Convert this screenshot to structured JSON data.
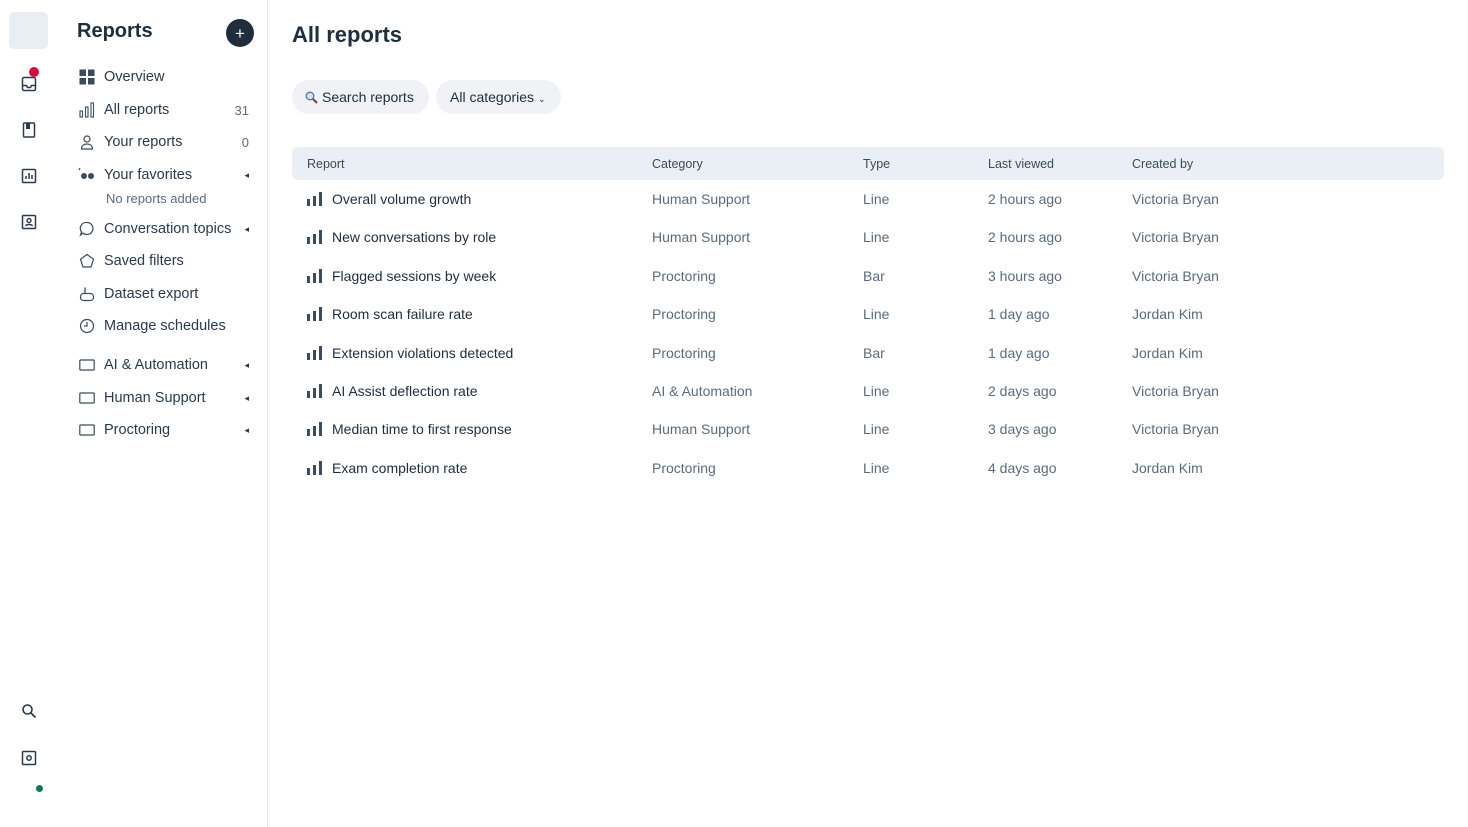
{
  "colors": {
    "accent": "#1f2d3d",
    "notification": "#d0103a",
    "online": "#0b7a52",
    "table_header_bg": "#eaeff5",
    "pill_bg": "#f0f2f5"
  },
  "rail": {
    "items": [
      {
        "icon": "inbox-icon"
      },
      {
        "icon": "book-icon"
      },
      {
        "icon": "bar-chart-icon"
      },
      {
        "icon": "contact-icon"
      }
    ],
    "bottom": [
      {
        "icon": "search-icon"
      },
      {
        "icon": "settings-icon"
      }
    ]
  },
  "sidebar": {
    "title": "Reports",
    "add_label": "+",
    "items": [
      {
        "label": "Overview",
        "icon": "grid-icon",
        "count": ""
      },
      {
        "label": "All reports",
        "icon": "bar-chart-icon",
        "count": "31"
      },
      {
        "label": "Your reports",
        "icon": "person-icon",
        "count": "0"
      },
      {
        "label": "Your favorites",
        "icon": "favorites-icon",
        "caret": "◂"
      },
      {
        "label": "Conversation topics",
        "icon": "chat-bubble-icon",
        "caret": "◂"
      },
      {
        "label": "Saved filters",
        "icon": "pentagon-icon"
      },
      {
        "label": "Dataset export",
        "icon": "export-icon"
      },
      {
        "label": "Manage schedules",
        "icon": "clock-icon"
      },
      {
        "label": "AI & Automation",
        "icon": "folder-icon",
        "caret": "◂"
      },
      {
        "label": "Human Support",
        "icon": "folder-icon",
        "caret": "◂"
      },
      {
        "label": "Proctoring",
        "icon": "folder-icon",
        "caret": "◂"
      }
    ],
    "favorites_empty": "No reports added"
  },
  "main": {
    "title": "All reports",
    "search_label": "Search reports",
    "category_filter": "All categories",
    "columns": [
      "Report",
      "Category",
      "Type",
      "Last viewed",
      "Created by"
    ],
    "rows": [
      {
        "name": "Overall volume growth",
        "category": "Human Support",
        "type": "Line",
        "last_viewed": "2 hours ago",
        "created_by": "Victoria Bryan"
      },
      {
        "name": "New conversations by role",
        "category": "Human Support",
        "type": "Line",
        "last_viewed": "2 hours ago",
        "created_by": "Victoria Bryan"
      },
      {
        "name": "Flagged sessions by week",
        "category": "Proctoring",
        "type": "Bar",
        "last_viewed": "3 hours ago",
        "created_by": "Victoria Bryan"
      },
      {
        "name": "Room scan failure rate",
        "category": "Proctoring",
        "type": "Line",
        "last_viewed": "1 day ago",
        "created_by": "Jordan Kim"
      },
      {
        "name": "Extension violations detected",
        "category": "Proctoring",
        "type": "Bar",
        "last_viewed": "1 day ago",
        "created_by": "Jordan Kim"
      },
      {
        "name": "AI Assist deflection rate",
        "category": "AI & Automation",
        "type": "Line",
        "last_viewed": "2 days ago",
        "created_by": "Victoria Bryan"
      },
      {
        "name": "Median time to first response",
        "category": "Human Support",
        "type": "Line",
        "last_viewed": "3 days ago",
        "created_by": "Victoria Bryan"
      },
      {
        "name": "Exam completion rate",
        "category": "Proctoring",
        "type": "Line",
        "last_viewed": "4 days ago",
        "created_by": "Jordan Kim"
      }
    ]
  }
}
